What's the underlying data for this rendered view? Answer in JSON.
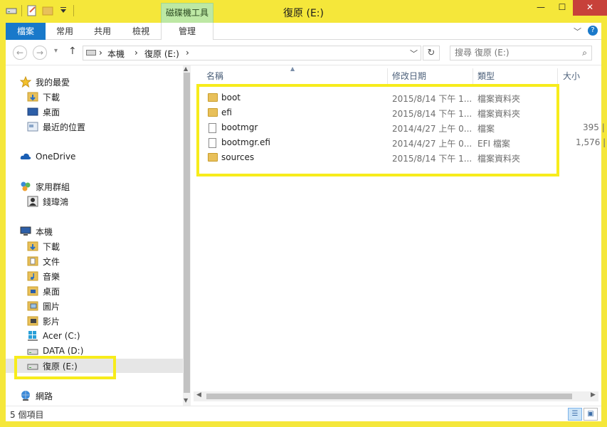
{
  "window": {
    "title": "復原 (E:)",
    "contextual_tab": "磁碟機工具",
    "buttons": {
      "minimize": "—",
      "maximize": "☐",
      "close": "✕"
    }
  },
  "qat": {
    "icons": [
      "drive-icon",
      "properties-icon",
      "new-folder-icon",
      "dropdown-icon"
    ]
  },
  "ribbon": {
    "tabs": [
      {
        "label": "檔案"
      },
      {
        "label": "常用"
      },
      {
        "label": "共用"
      },
      {
        "label": "檢視"
      },
      {
        "label": "管理"
      }
    ],
    "expand": "﹀",
    "help": "?"
  },
  "address": {
    "back": "←",
    "forward": "→",
    "recent": "▾",
    "up": "↑",
    "crumbs": [
      "本機",
      "復原 (E:)"
    ],
    "separator": "›",
    "dropdown": "﹀",
    "refresh": "↻",
    "search_placeholder": "搜尋 復原 (E:)",
    "search_icon": "⌕"
  },
  "nav": {
    "favorites_label": "我的最愛",
    "favorites": [
      "下載",
      "桌面",
      "最近的位置"
    ],
    "onedrive": "OneDrive",
    "homegroup_label": "家用群組",
    "homegroup_user": "錢瑋鴻",
    "thispc_label": "本機",
    "thispc_items": [
      "下載",
      "文件",
      "音樂",
      "桌面",
      "圖片",
      "影片",
      "Acer (C:)",
      "DATA (D:)",
      "復原 (E:)"
    ],
    "network": "網路"
  },
  "columns": {
    "name": "名稱",
    "date": "修改日期",
    "type": "類型",
    "size": "大小"
  },
  "files": [
    {
      "name": "boot",
      "date": "2015/8/14 下午 1...",
      "type": "檔案資料夾",
      "size": "",
      "kind": "folder"
    },
    {
      "name": "efi",
      "date": "2015/8/14 下午 1...",
      "type": "檔案資料夾",
      "size": "",
      "kind": "folder"
    },
    {
      "name": "bootmgr",
      "date": "2014/4/27 上午 0...",
      "type": "檔案",
      "size": "395 |",
      "kind": "file"
    },
    {
      "name": "bootmgr.efi",
      "date": "2014/4/27 上午 0...",
      "type": "EFI 檔案",
      "size": "1,576 |",
      "kind": "file"
    },
    {
      "name": "sources",
      "date": "2015/8/14 下午 1...",
      "type": "檔案資料夾",
      "size": "",
      "kind": "folder"
    }
  ],
  "status": {
    "item_count": "5 個項目"
  },
  "colors": {
    "frame": "#f5e73a",
    "file_tab": "#1979ca",
    "context_tab": "#bde8a4",
    "close": "#c7413a",
    "highlight": "#f7ec1c"
  }
}
